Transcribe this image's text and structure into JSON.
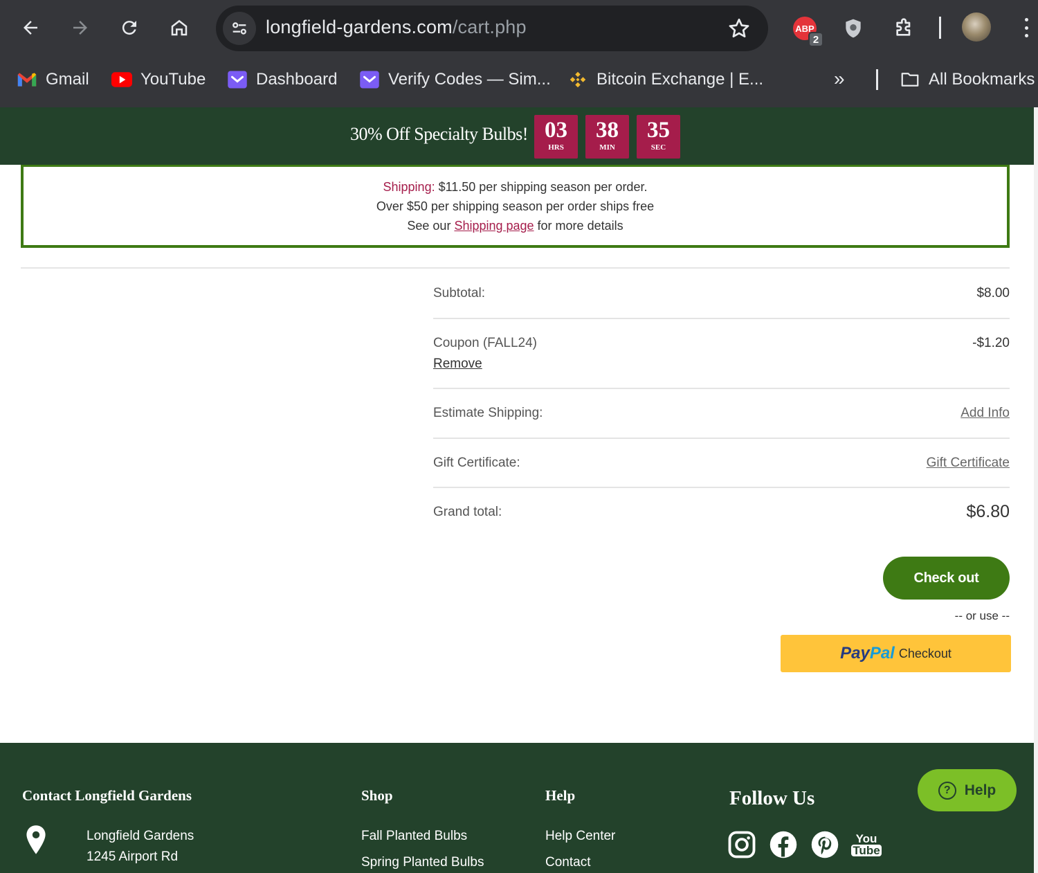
{
  "browser": {
    "url_domain": "longfield-gardens.com",
    "url_path": "/cart.php",
    "extension_badge": "2",
    "extension_abp_label": "ABP",
    "bookmarks": [
      {
        "label": "Gmail",
        "icon": "gmail-icon"
      },
      {
        "label": "YouTube",
        "icon": "youtube-icon"
      },
      {
        "label": "Dashboard",
        "icon": "mail-icon"
      },
      {
        "label": "Verify Codes — Sim...",
        "icon": "mail-icon"
      },
      {
        "label": "Bitcoin Exchange | E...",
        "icon": "binance-icon"
      }
    ],
    "more_label": "»",
    "all_bookmarks": "All Bookmarks"
  },
  "promo": {
    "text": "30% Off Specialty Bulbs!",
    "countdown": [
      {
        "num": "03",
        "unit": "HRS"
      },
      {
        "num": "38",
        "unit": "MIN"
      },
      {
        "num": "35",
        "unit": "SEC"
      }
    ]
  },
  "shipping": {
    "label": "Shipping:",
    "line1_rest": " $11.50  per shipping season per order.",
    "line2": "Over $50 per shipping season per order ships free",
    "line3_pre": "See our ",
    "line3_link": "Shipping page",
    "line3_post": " for more details"
  },
  "totals": {
    "subtotal_label": "Subtotal:",
    "subtotal_value": "$8.00",
    "coupon_label": "Coupon (FALL24)",
    "coupon_value": "-$1.20",
    "coupon_remove": "Remove",
    "shipping_label": "Estimate Shipping:",
    "shipping_link": "Add Info",
    "gift_label": "Gift Certificate:",
    "gift_link": "Gift Certificate",
    "grand_label": "Grand total:",
    "grand_value": "$6.80"
  },
  "checkout": {
    "button": "Check out",
    "or_use": "-- or use --",
    "paypal_pay": "Pay",
    "paypal_pal": "Pal",
    "paypal_checkout": "Checkout"
  },
  "footer": {
    "contact_heading": "Contact Longfield Gardens",
    "contact_lines": [
      "Longfield Gardens",
      "1245 Airport Rd"
    ],
    "shop_heading": "Shop",
    "shop_items": [
      "Fall Planted Bulbs",
      "Spring Planted Bulbs"
    ],
    "help_heading": "Help",
    "help_items": [
      "Help Center",
      "Contact"
    ],
    "follow_heading": "Follow Us",
    "social": [
      "instagram-icon",
      "facebook-icon",
      "pinterest-icon",
      "youtube-icon"
    ],
    "youtube_text_top": "You",
    "youtube_text_bottom": "Tube",
    "help_button": "Help"
  },
  "colors": {
    "brand_green_dark": "#23422b",
    "brand_green": "#3e7a14",
    "accent_red": "#a51d4b",
    "paypal_yellow": "#ffc43a",
    "help_green": "#7cbf27"
  }
}
